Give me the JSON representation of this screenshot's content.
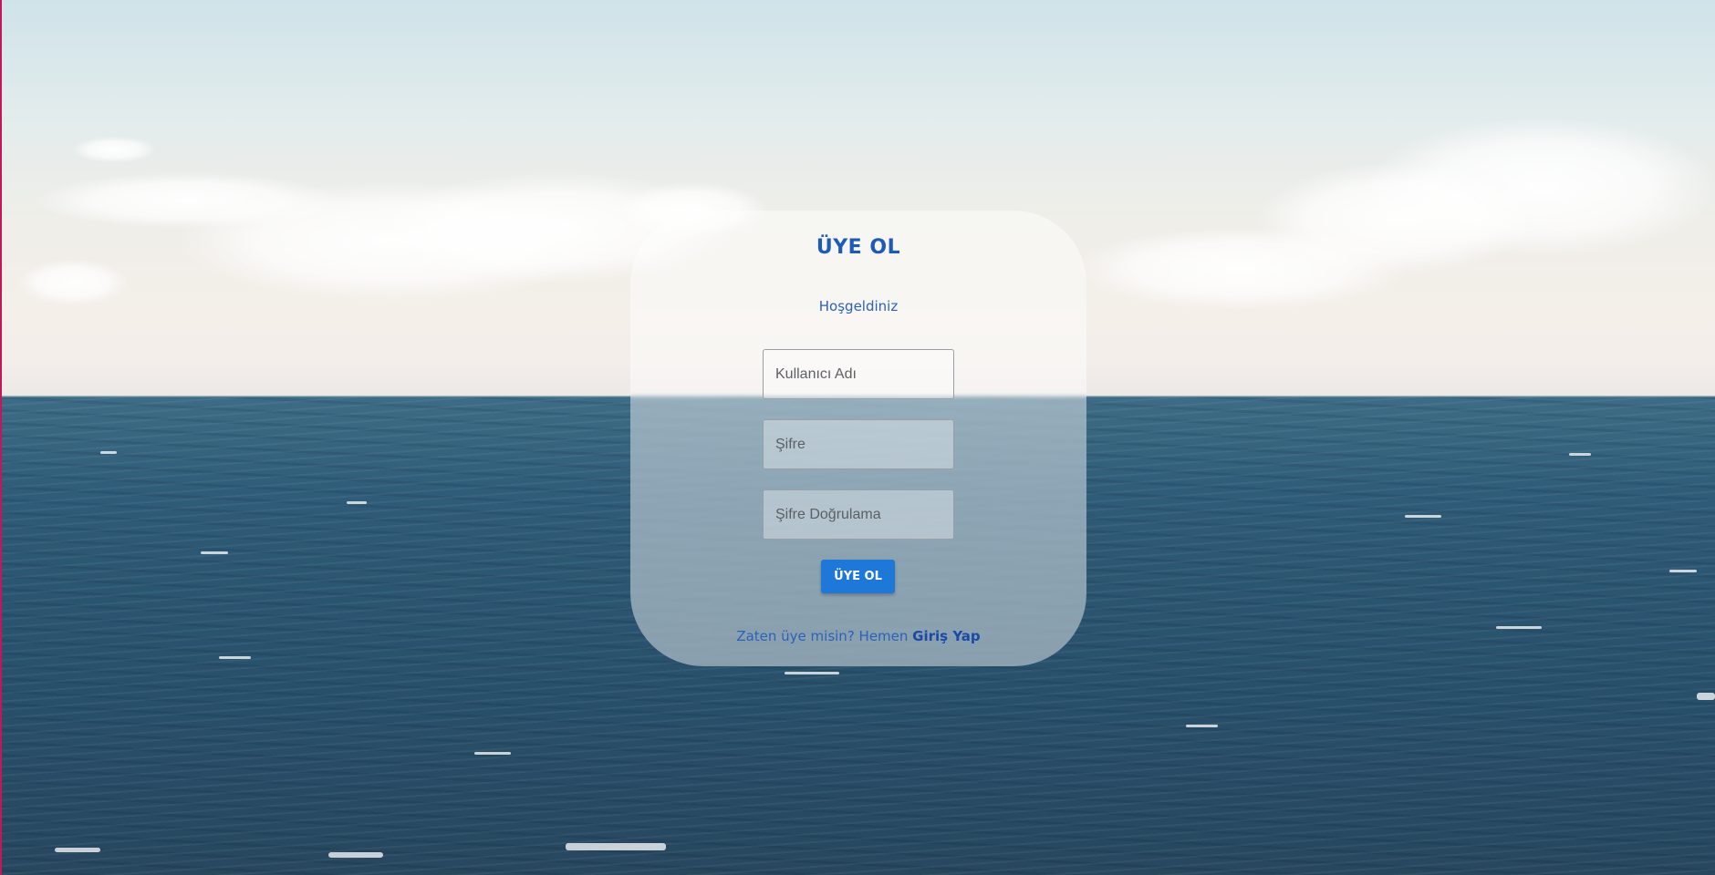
{
  "signup_form": {
    "title": "ÜYE OL",
    "subtitle": "Hoşgeldiniz",
    "username_placeholder": "Kullanıcı Adı",
    "password_placeholder": "Şifre",
    "confirm_placeholder": "Şifre Doğrulama",
    "submit_label": "ÜYE OL",
    "footer_text": "Zaten üye misin? Hemen ",
    "login_link_label": "Giriş Yap"
  },
  "colors": {
    "accent": "#1e78d8",
    "title_text": "#1e5bb8",
    "link_text": "#1a49a8"
  }
}
